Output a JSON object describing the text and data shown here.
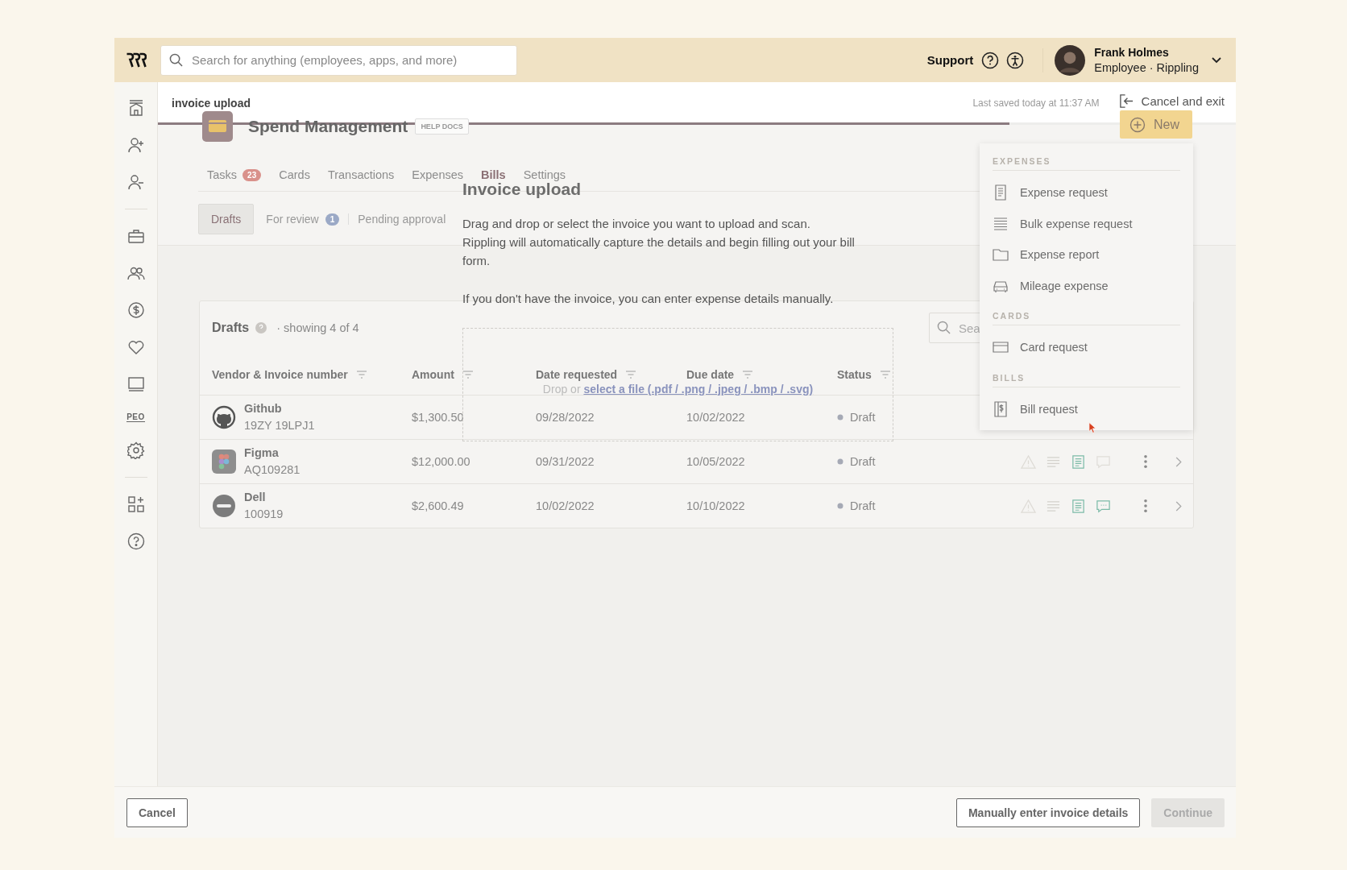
{
  "top_bar": {
    "search": {
      "placeholder": "Search for anything (employees, apps, and more)"
    },
    "support": "Support",
    "user": {
      "name": "Frank Holmes",
      "role": "Employee · Rippling"
    }
  },
  "sidebar": {
    "peo_label": "PEO"
  },
  "upload_header": {
    "label": "invoice upload",
    "last_saved": "Last saved today at 11:37 AM",
    "cancel_exit": "Cancel and exit",
    "progress": {
      "level": 0.79
    }
  },
  "spend_page": {
    "title": "Spend Management",
    "help_docs": "HELP DOCS",
    "new_button": "New",
    "tabs": [
      {
        "label": "Tasks",
        "badge": "23",
        "selected": false
      },
      {
        "label": "Cards",
        "selected": false
      },
      {
        "label": "Transactions",
        "selected": false
      },
      {
        "label": "Expenses",
        "selected": false
      },
      {
        "label": "Bills",
        "selected": true
      },
      {
        "label": "Settings",
        "selected": false
      }
    ],
    "subtabs": [
      {
        "label": "Drafts",
        "selected": true
      },
      {
        "label": "For review",
        "badge": "1",
        "selected": false
      },
      {
        "label": "Pending approval",
        "selected": false
      }
    ]
  },
  "drafts_table": {
    "title": "Drafts",
    "count": "· showing 4 of 4",
    "search": {
      "placeholder": "Sea"
    },
    "columns": [
      "Vendor & Invoice number",
      "Amount",
      "Date requested",
      "Due date",
      "Status"
    ],
    "rows": [
      {
        "vendor": "Github",
        "number": "19ZY 19LPJ1",
        "amount": "$1,300.50",
        "date_requested": "09/28/2022",
        "due_date": "10/02/2022",
        "status": "Draft"
      },
      {
        "vendor": "Figma",
        "number": "AQ109281",
        "amount": "$12,000.00",
        "date_requested": "09/31/2022",
        "due_date": "10/05/2022",
        "status": "Draft",
        "comments": false
      },
      {
        "vendor": "Dell",
        "number": "100919",
        "amount": "$2,600.49",
        "date_requested": "10/02/2022",
        "due_date": "10/10/2022",
        "status": "Draft",
        "comments": true
      }
    ]
  },
  "new_menu": {
    "sections": [
      {
        "heading": "EXPENSES",
        "items": [
          "Expense request",
          "Bulk expense request",
          "Expense report",
          "Mileage expense"
        ]
      },
      {
        "heading": "CARDS",
        "items": [
          "Card request"
        ]
      },
      {
        "heading": "BILLS",
        "items": [
          "Bill request"
        ]
      }
    ]
  },
  "invoice_upload": {
    "title": "Invoice upload",
    "paragraphs": [
      "Drag and drop or select the invoice you want to upload and scan. Rippling will automatically capture the details and begin filling out your bill form.",
      "If you don't have the invoice, you can enter expense details manually."
    ],
    "dropzone": {
      "prompt": "Drop or",
      "link": "select a file (.pdf / .png / .jpeg / .bmp / .svg)"
    }
  },
  "footer": {
    "cancel": "Cancel",
    "manual": "Manually enter invoice details",
    "continue": {
      "label": "Continue",
      "disabled": true
    }
  }
}
